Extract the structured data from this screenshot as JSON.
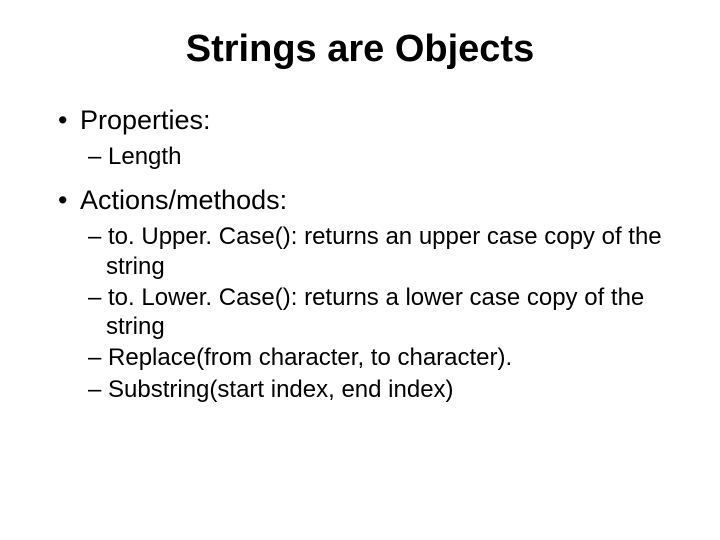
{
  "title": "Strings are Objects",
  "items": [
    {
      "label": "Properties:",
      "sub": [
        "Length"
      ]
    },
    {
      "label": "Actions/methods:",
      "sub": [
        "to. Upper. Case(): returns an upper case copy of the string",
        "to. Lower. Case(): returns a lower case copy of the string",
        "Replace(from character, to character).",
        "Substring(start index, end index)"
      ]
    }
  ]
}
